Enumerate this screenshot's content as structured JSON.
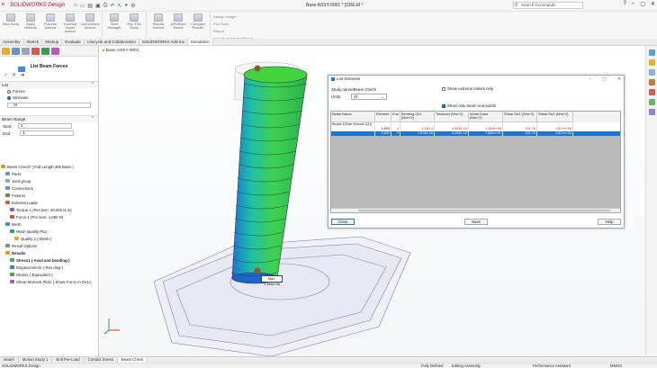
{
  "app": {
    "brand": "SOLIDWORKS Design",
    "title": "Base ASSY-0001 * [SDE.M *",
    "search_placeholder": "Search Commands",
    "colors": {
      "brand": "#d21f26",
      "accent": "#1a75d6"
    }
  },
  "ribbon": {
    "groups": [
      {
        "buttons": [
          "New Study",
          "Apply Material",
          "Fixtures Advisor",
          "External Loads Advisor",
          "Connections Advisor"
        ]
      },
      {
        "buttons": [
          "Shell Manager",
          "Run This Study"
        ]
      },
      {
        "buttons": [
          "Results Advisor",
          "Deformed Result",
          "Compare Results"
        ]
      }
    ],
    "small": [
      "Design Insight",
      "Plot Tools",
      "Report",
      "Include Image for Report"
    ]
  },
  "command_tabs": [
    "Assembly",
    "Sketch",
    "Markup",
    "Evaluate",
    "Lifecycle and Collaboration",
    "SOLIDWORKS Add-Ins",
    "Simulation"
  ],
  "active_command_tab": "Simulation",
  "left_panel": {
    "title": "List Beam Forces",
    "list_label": "List",
    "options": [
      "Forces",
      "Stresses"
    ],
    "selected_option": "Stresses",
    "units": "SI",
    "beam_range_label": "Beam Range",
    "start_label": "Start:",
    "start_value": "1",
    "end_label": "End:",
    "end_value": "1"
  },
  "tree": [
    {
      "label": "Beam Check* (-Full Length 300 Base-)",
      "indent": 0
    },
    {
      "label": "Parts",
      "indent": 1
    },
    {
      "label": "Joint group",
      "indent": 1
    },
    {
      "label": "Connections",
      "indent": 1
    },
    {
      "label": "Fixtures",
      "indent": 1
    },
    {
      "label": "External Loads",
      "indent": 1
    },
    {
      "label": "Torque-1 (Per item: 20,000 N.m)",
      "indent": 2
    },
    {
      "label": "Force-1 (Per item: 1,000 N)",
      "indent": 2
    },
    {
      "label": "Mesh",
      "indent": 1
    },
    {
      "label": "Mesh Quality Plot",
      "indent": 2
    },
    {
      "label": "Quality 1 (-Mesh-)",
      "indent": 3
    },
    {
      "label": "Result Options",
      "indent": 1
    },
    {
      "label": "Results",
      "indent": 1
    },
    {
      "label": "Stress1 (-Axial and bending-)",
      "indent": 2
    },
    {
      "label": "Displacement1 (-Res disp-)",
      "indent": 2
    },
    {
      "label": "Strain1 (-Equivalent-)",
      "indent": 2
    },
    {
      "label": "Shear-Moment Plot1 (-Shear Force in Dir1-)",
      "indent": 2
    }
  ],
  "viewport": {
    "breadcrumb": "Base ASSY-0001",
    "probe_label": "Max: 1.356e+06"
  },
  "dialog": {
    "title": "List Stresses",
    "study_label": "Study name/Beam Check",
    "units_label": "Units:",
    "units_value": "SI",
    "show_extreme_label": "Show extreme values only",
    "show_extreme_checked": false,
    "show_end_points_label": "Show only beam end points",
    "show_end_points_checked": true,
    "columns": [
      "Beam Name",
      "Element",
      "End",
      "Bending Dir1 (N/m^2)",
      "Torsional (N/m^2)",
      "Worst Case (N/m^2)",
      "Shear Dir1 (N/m^2)",
      "Shear Dir2 (N/m^2)"
    ],
    "rows": [
      {
        "name": "Beam-1(Side Wound-1[1])",
        "element": "",
        "end": "",
        "bending": "",
        "torsional": "",
        "worst": "",
        "shear1": "",
        "shear2": "",
        "selected": false
      },
      {
        "name": "",
        "element": "4,803",
        "end": "1",
        "bending": "1.33e-4",
        "torsional": "4.663e-16",
        "worst": "1.356e+06",
        "shear1": "191.76",
        "shear2": "1.817e+06",
        "selected": false
      },
      {
        "name": "",
        "element": "4,802",
        "end": "2",
        "bending": "7.678e-16",
        "torsional": "4.195e-12",
        "worst": "7.864e+07",
        "shear1": "191.76",
        "shear2": "1.817e+06",
        "selected": true
      }
    ],
    "buttons": [
      "Close",
      "Save",
      "Help"
    ]
  },
  "bottom_tabs": [
    "Model",
    "Motion Study 1",
    "Bolt Pre-Load",
    "Contact Stress",
    "Beam Check"
  ],
  "active_bottom_tab": "Beam Check",
  "status": {
    "left": "SOLIDWORKS Design",
    "fully_defined": "Fully Defined",
    "editing": "Editing Assembly",
    "perf": "Performance Assistant",
    "units": "MMGS"
  }
}
